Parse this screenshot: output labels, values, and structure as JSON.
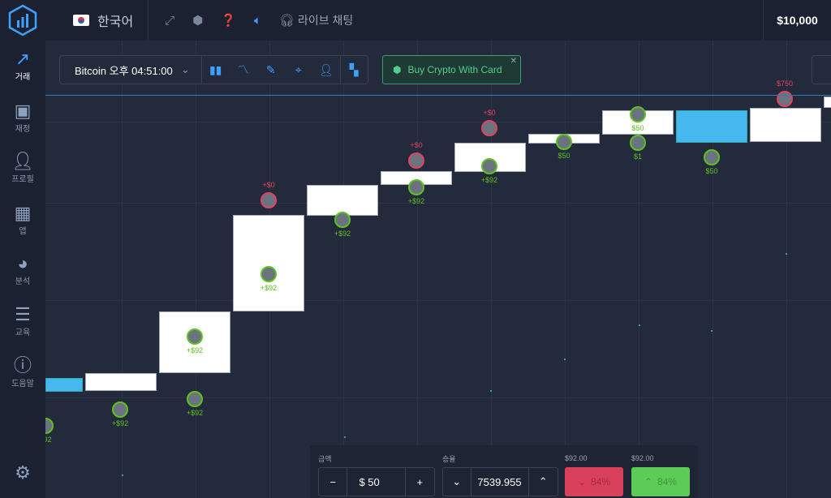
{
  "header": {
    "language": "한국어",
    "live_chat": "라이브 채팅",
    "balance": "$10,000",
    "icons": [
      "fullscreen-icon",
      "hexagon-coin-icon",
      "help-icon",
      "sound-icon",
      "headset-icon"
    ]
  },
  "sidebar": {
    "items": [
      {
        "label": "거래",
        "icon": "trend-up-icon",
        "active": true
      },
      {
        "label": "재정",
        "icon": "cash-icon"
      },
      {
        "label": "프로필",
        "icon": "user-icon"
      },
      {
        "label": "앱",
        "icon": "apps-icon"
      },
      {
        "label": "분석",
        "icon": "pie-chart-icon"
      },
      {
        "label": "교육",
        "icon": "book-icon"
      },
      {
        "label": "도움말",
        "icon": "info-icon"
      }
    ],
    "settings_icon": "gear-icon"
  },
  "toolbar": {
    "asset": "Bitcoin 오후 04:51:00",
    "tools": [
      "candles-icon",
      "indicator-icon",
      "pencil-icon",
      "crosshair-icon",
      "add-user-icon",
      "layout-icon"
    ]
  },
  "promo": {
    "label": "Buy Crypto With Card"
  },
  "markers": [
    "+$92",
    "+$92",
    "+$92",
    "+$92",
    "+$0",
    "+$92",
    "+$92",
    "+$0",
    "+$92",
    "+$0",
    "$50",
    "$50",
    "$1",
    "$50",
    "$750",
    "$92"
  ],
  "trade": {
    "amount_label": "금액",
    "amount": "$ 50",
    "rate_label": "승율",
    "rate": "7539.955",
    "down_payout": "$92.00",
    "up_payout": "$92.00",
    "down_pct": "84%",
    "up_pct": "84%"
  },
  "colors": {
    "accent": "#3ea0ff",
    "up": "#5ccb58",
    "down": "#d9405c",
    "win": "#5dc21e"
  }
}
